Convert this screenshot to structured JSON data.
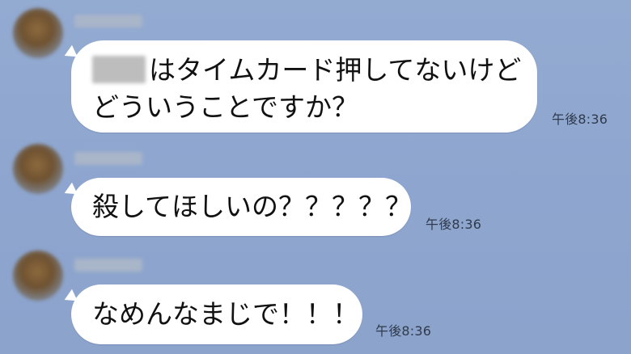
{
  "messages": [
    {
      "redacted_name": "■■■",
      "text_line1": "はタイムカード押してないけど",
      "text_line2": "どういうことですか？",
      "time": "午後8:36"
    },
    {
      "text": "殺してほしいの？？？？？",
      "time": "午後8:36"
    },
    {
      "text": "なめんなまじで！！！",
      "time": "午後8:36"
    }
  ],
  "colors": {
    "background": "#8fa6cf",
    "bubble": "#ffffff",
    "time_text": "#2f3a4c"
  },
  "icons": [
    "avatar-blurred",
    "bubble-tail"
  ]
}
